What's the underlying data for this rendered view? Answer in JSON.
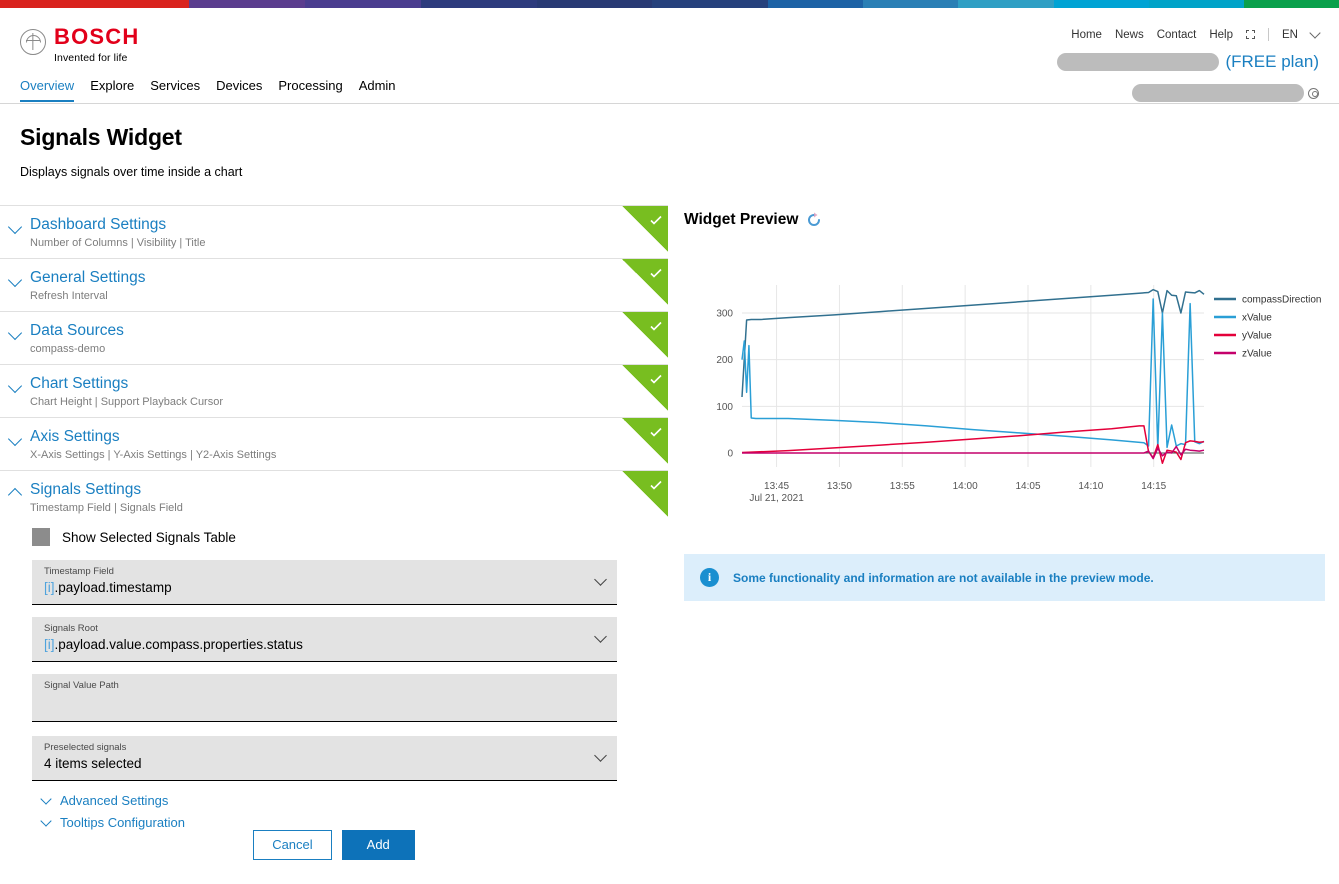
{
  "brand_bar": {
    "segments": [
      "#d9231e",
      "#5b3d8e",
      "#4a3d8f",
      "#2d3b7d",
      "#283a74",
      "#26417c",
      "#1d62a5",
      "#2a7fb5",
      "#2f9fc4",
      "#00a3d4",
      "#00a3c8",
      "#0aa04b"
    ]
  },
  "header": {
    "logo": {
      "word": "BOSCH",
      "claim": "Invented for life",
      "anchor_icon": "bosch-anchor-icon"
    },
    "top_links": [
      "Home",
      "News",
      "Contact",
      "Help"
    ],
    "external_icon": "external-link-icon",
    "language": "EN",
    "language_chevron_icon": "chevron-down-icon",
    "plan_label": "(FREE plan)",
    "account_redacted_width": 162,
    "org_redacted_width": 172,
    "org_icon": "user-circle-icon"
  },
  "nav": {
    "items": [
      {
        "label": "Overview",
        "active": true
      },
      {
        "label": "Explore",
        "active": false
      },
      {
        "label": "Services",
        "active": false
      },
      {
        "label": "Devices",
        "active": false
      },
      {
        "label": "Processing",
        "active": false
      },
      {
        "label": "Admin",
        "active": false
      }
    ]
  },
  "page": {
    "title": "Signals Widget",
    "subtitle": "Displays signals over time inside a chart"
  },
  "accordions": [
    {
      "title": "Dashboard Settings",
      "subtitle": "Number of Columns | Visibility | Title",
      "expanded": false,
      "complete": true
    },
    {
      "title": "General Settings",
      "subtitle": "Refresh Interval",
      "expanded": false,
      "complete": true
    },
    {
      "title": "Data Sources",
      "subtitle": "compass-demo",
      "expanded": false,
      "complete": true
    },
    {
      "title": "Chart Settings",
      "subtitle": "Chart Height | Support Playback Cursor",
      "expanded": false,
      "complete": true
    },
    {
      "title": "Axis Settings",
      "subtitle": "X-Axis Settings | Y-Axis Settings | Y2-Axis Settings",
      "expanded": false,
      "complete": true
    },
    {
      "title": "Signals Settings",
      "subtitle": "Timestamp Field | Signals Field",
      "expanded": true,
      "complete": true
    }
  ],
  "signals_settings": {
    "show_table_label": "Show Selected Signals Table",
    "show_table_checked": true,
    "fields": [
      {
        "label": "Timestamp Field",
        "prefix": "[i]",
        "value": ".payload.timestamp",
        "has_chevron": true
      },
      {
        "label": "Signals Root",
        "prefix": "[i]",
        "value": ".payload.value.compass.properties.status",
        "has_chevron": true
      },
      {
        "label": "Signal Value Path",
        "prefix": "",
        "value": "",
        "has_chevron": false
      },
      {
        "label": "Preselected signals",
        "prefix": "",
        "value": "4 items selected",
        "has_chevron": true
      }
    ],
    "sublinks": [
      "Advanced Settings",
      "Tooltips Configuration"
    ]
  },
  "preview": {
    "title": "Widget Preview",
    "refresh_icon": "refresh-spinner-icon",
    "info_icon": "info-icon",
    "info_text": "Some functionality and information are not available in the preview mode."
  },
  "footer": {
    "cancel_label": "Cancel",
    "add_label": "Add"
  },
  "chart_data": {
    "type": "line",
    "title": "",
    "xlabel": "",
    "ylabel": "",
    "grid": true,
    "legend_position": "right",
    "x_tick_labels": [
      "13:45",
      "13:50",
      "13:55",
      "14:00",
      "14:05",
      "14:10",
      "14:15"
    ],
    "x_date_label": "Jul 21, 2021",
    "y_tick_labels": [
      "0",
      "100",
      "200",
      "300"
    ],
    "ylim": [
      -30,
      360
    ],
    "series": [
      {
        "name": "compassDirection",
        "color": "#31708f",
        "x": [
          0,
          1,
          2,
          4,
          10,
          20,
          30,
          40,
          50,
          60,
          70,
          80,
          88,
          89,
          90,
          91,
          92,
          93,
          94,
          95,
          96,
          97,
          98,
          99,
          100
        ],
        "y": [
          120,
          285,
          286,
          286,
          290,
          296,
          303,
          310,
          317,
          324,
          331,
          338,
          344,
          350,
          346,
          300,
          348,
          338,
          337,
          300,
          345,
          344,
          343,
          348,
          340
        ]
      },
      {
        "name": "xValue",
        "color": "#2a9fd6",
        "x": [
          0,
          0.5,
          1,
          1.5,
          2,
          3,
          10,
          20,
          30,
          40,
          50,
          60,
          70,
          80,
          87,
          88,
          89,
          90,
          91,
          92,
          93,
          94,
          95,
          96,
          97,
          98,
          99,
          100
        ],
        "y": [
          200,
          240,
          130,
          230,
          75,
          74,
          74,
          70,
          65,
          58,
          50,
          43,
          36,
          28,
          22,
          15,
          330,
          10,
          300,
          12,
          60,
          15,
          20,
          18,
          320,
          24,
          20,
          25
        ]
      },
      {
        "name": "yValue",
        "color": "#e4003a",
        "x": [
          0,
          10,
          20,
          30,
          40,
          50,
          60,
          70,
          80,
          86,
          87,
          88,
          89,
          90,
          91,
          92,
          93,
          94,
          95,
          96,
          97,
          98,
          99,
          100
        ],
        "y": [
          1,
          5,
          11,
          17,
          23,
          30,
          37,
          45,
          52,
          58,
          58,
          3,
          -10,
          18,
          -22,
          6,
          4,
          2,
          -14,
          22,
          26,
          25,
          23,
          24
        ]
      },
      {
        "name": "zValue",
        "color": "#c4006b",
        "x": [
          0,
          10,
          20,
          30,
          40,
          50,
          60,
          70,
          80,
          86,
          87,
          88,
          89,
          90,
          91,
          92,
          93,
          94,
          95,
          96,
          97,
          98,
          99,
          100
        ],
        "y": [
          0,
          0,
          0,
          0,
          0,
          0,
          0,
          0,
          0,
          0,
          0,
          4,
          -12,
          10,
          -6,
          2,
          0,
          14,
          -4,
          8,
          6,
          5,
          4,
          6
        ]
      }
    ]
  }
}
